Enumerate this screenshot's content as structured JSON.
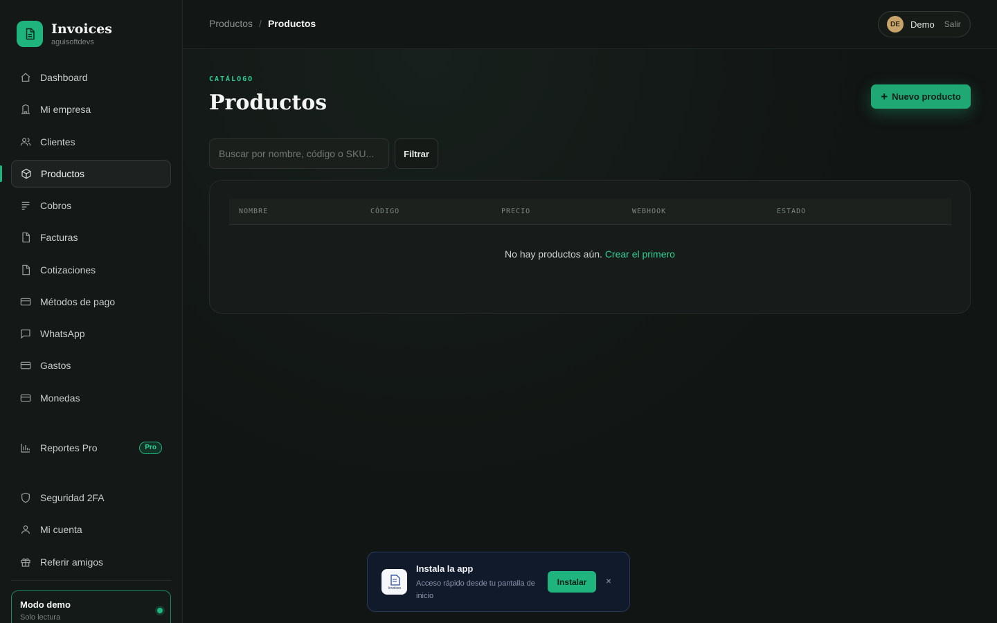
{
  "brand": {
    "title": "Invoices",
    "subtitle": "aguisoftdevs"
  },
  "sidebar": {
    "items": [
      {
        "label": "Dashboard",
        "icon": "home-icon"
      },
      {
        "label": "Mi empresa",
        "icon": "building-icon"
      },
      {
        "label": "Clientes",
        "icon": "users-icon"
      },
      {
        "label": "Productos",
        "icon": "box-icon",
        "active": true
      },
      {
        "label": "Cobros",
        "icon": "list-icon"
      },
      {
        "label": "Facturas",
        "icon": "file-icon"
      },
      {
        "label": "Cotizaciones",
        "icon": "file-icon"
      },
      {
        "label": "Métodos de pago",
        "icon": "card-icon"
      },
      {
        "label": "WhatsApp",
        "icon": "chat-icon"
      },
      {
        "label": "Gastos",
        "icon": "card-icon"
      },
      {
        "label": "Monedas",
        "icon": "card-icon"
      },
      {
        "label": "Reportes Pro",
        "icon": "bar-chart-icon",
        "badge": "Pro"
      },
      {
        "label": "Seguridad 2FA",
        "icon": "shield-icon"
      },
      {
        "label": "Mi cuenta",
        "icon": "user-icon"
      },
      {
        "label": "Referir amigos",
        "icon": "gift-icon"
      }
    ],
    "demo": {
      "title": "Modo demo",
      "subtitle": "Solo lectura"
    }
  },
  "topbar": {
    "breadcrumb": [
      "Productos",
      "Productos"
    ],
    "separator": "/",
    "user": {
      "initials": "DE",
      "name": "Demo",
      "logout": "Salir"
    }
  },
  "main": {
    "eyebrow": "CATÁLOGO",
    "title": "Productos",
    "new_button": "Nuevo producto",
    "search_placeholder": "Buscar por nombre, código o SKU...",
    "filter_button": "Filtrar",
    "table": {
      "columns": [
        "NOMBRE",
        "CÓDIGO",
        "PRECIO",
        "WEBHOOK",
        "ESTADO"
      ],
      "empty_text": "No hay productos aún.",
      "empty_link": "Crear el primero"
    }
  },
  "install_toast": {
    "title": "Instala la app",
    "description": "Acceso rápido desde tu pantalla de inicio",
    "button": "Instalar",
    "close": "×",
    "icon_text": "Invoices"
  },
  "colors": {
    "accent": "#1fb47e",
    "background": "#111513",
    "sidebar": "#141816",
    "toast_bg": "#111a2b"
  }
}
